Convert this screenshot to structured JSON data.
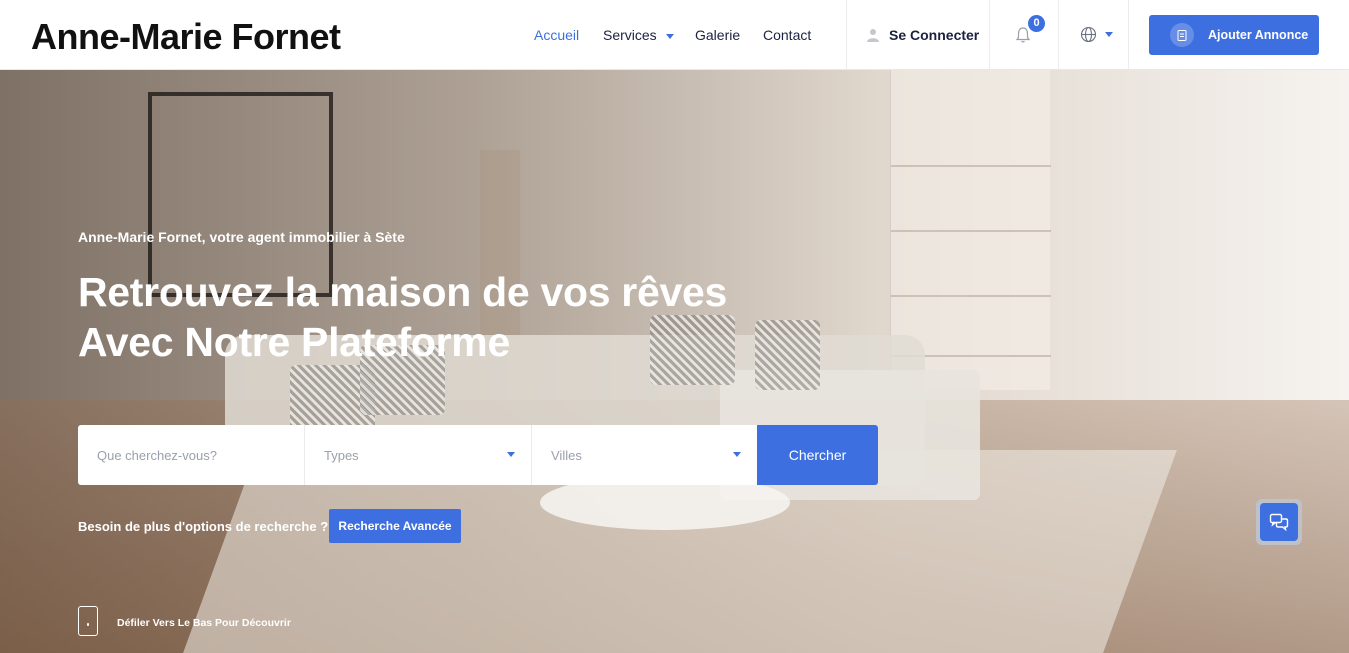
{
  "header": {
    "brand": "Anne-Marie Fornet",
    "nav": {
      "home": "Accueil",
      "services": "Services",
      "gallery": "Galerie",
      "contact": "Contact"
    },
    "login": "Se Connecter",
    "notifications_count": "0",
    "add_listing": "Ajouter Annonce"
  },
  "hero": {
    "tagline": "Anne-Marie Fornet, votre agent immobilier à Sète",
    "title_line1": "Retrouvez la maison de vos rêves",
    "title_line2": "Avec Notre Plateforme",
    "search": {
      "query_placeholder": "Que cherchez-vous?",
      "types_label": "Types",
      "cities_label": "Villes",
      "submit": "Chercher"
    },
    "more_options": "Besoin de plus d'options de recherche ?",
    "advanced_search": "Recherche Avancée",
    "scroll_hint": "Défiler Vers Le Bas Pour Découvrir"
  },
  "colors": {
    "accent": "#3d6fe0",
    "text_dark": "#1b2240"
  },
  "icons": [
    "user-icon",
    "bell-icon",
    "globe-icon",
    "document-icon",
    "chat-icon",
    "mouse-icon"
  ]
}
